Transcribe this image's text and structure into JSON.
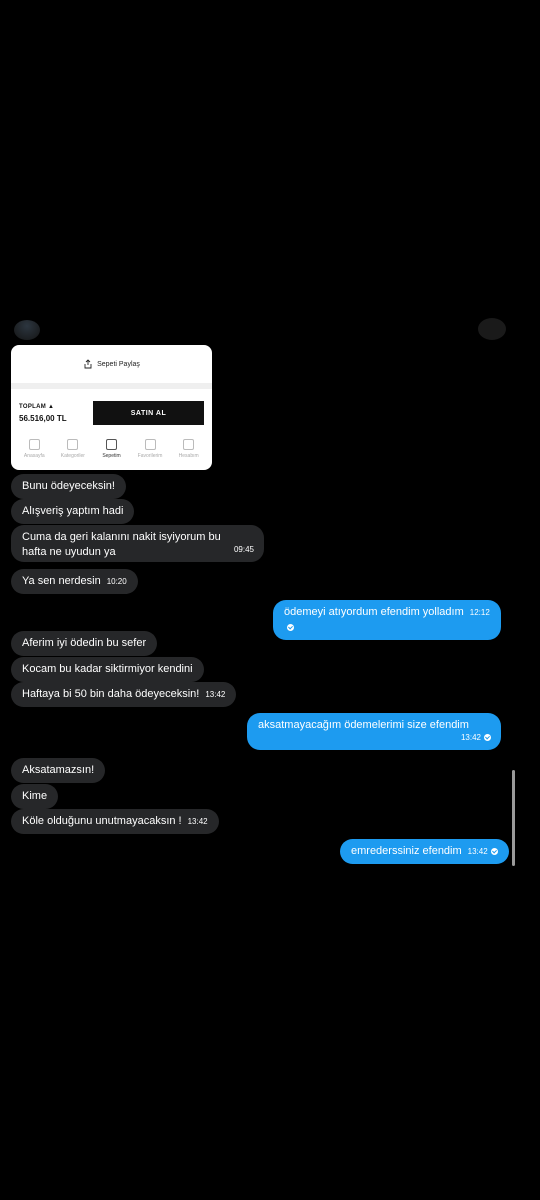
{
  "cart_card": {
    "share_label": "Sepeti Paylaş",
    "total_label": "TOPLAM",
    "total_value": "56.516,00 TL",
    "buy_label": "SATIN AL",
    "nav": [
      "Anasayfa",
      "Kategoriler",
      "Sepetim",
      "Favorilerim",
      "Hesabım"
    ]
  },
  "messages": [
    {
      "dir": "in",
      "text": "Bunu ödeyeceksin!"
    },
    {
      "dir": "in",
      "text": "Alışveriş yaptım hadi"
    },
    {
      "dir": "in",
      "text": "Cuma da geri kalanını nakit isyiyorum bu hafta ne uyudun ya",
      "time": "09:45"
    },
    {
      "dir": "in",
      "text": "Ya sen nerdesin",
      "time": "10:20"
    },
    {
      "dir": "out",
      "text": "ödemeyi atıyordum efendim yolladım",
      "time": "12:12"
    },
    {
      "dir": "in",
      "text": "Aferim iyi ödedin bu sefer"
    },
    {
      "dir": "in",
      "text": "Kocam bu kadar siktirmiyor kendini"
    },
    {
      "dir": "in",
      "text": "Haftaya bi 50 bin daha ödeyeceksin!",
      "time": "13:42"
    },
    {
      "dir": "out",
      "text": "aksatmayacağım ödemelerimi size efendim",
      "time": "13:42"
    },
    {
      "dir": "in",
      "text": "Aksatamazsın!"
    },
    {
      "dir": "in",
      "text": "Kime"
    },
    {
      "dir": "in",
      "text": "Köle olduğunu unutmayacaksın !",
      "time": "13:42"
    },
    {
      "dir": "out",
      "text": "emrederssiniz efendim",
      "time": "13:42"
    }
  ]
}
